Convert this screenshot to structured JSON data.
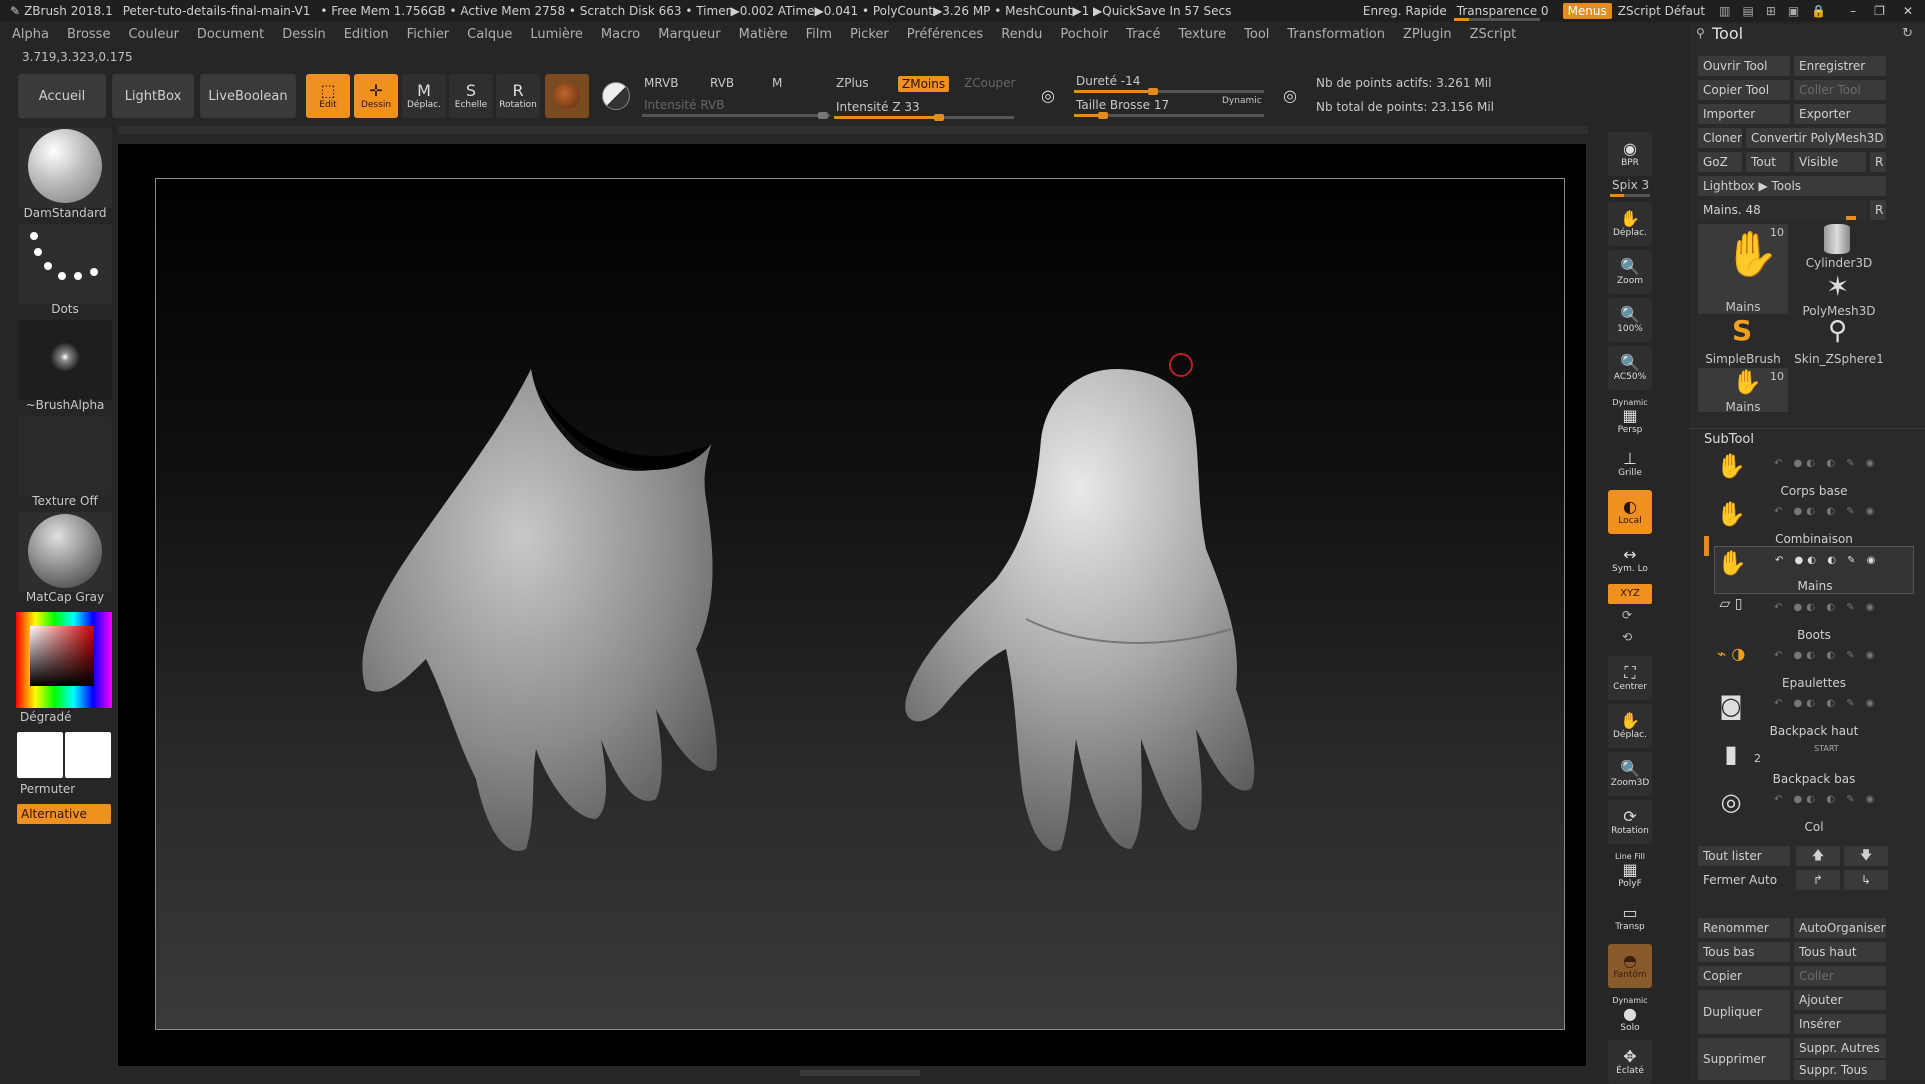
{
  "titlebar": {
    "app": "ZBrush 2018.1",
    "file": "Peter-tuto-details-final-main-V1",
    "stats": "• Free Mem 1.756GB • Active Mem 2758 • Scratch Disk 663 • Timer▶0.002 ATime▶0.041 • PolyCount▶3.26 MP • MeshCount▶1 ▶QuickSave In 57 Secs",
    "quicksave": "Enreg. Rapide",
    "transparence": "Transparence 0",
    "menus": "Menus",
    "zscript": "ZScript Défaut"
  },
  "menubar": [
    "Alpha",
    "Brosse",
    "Couleur",
    "Document",
    "Dessin",
    "Edition",
    "Fichier",
    "Calque",
    "Lumière",
    "Macro",
    "Marqueur",
    "Matière",
    "Film",
    "Picker",
    "Préférences",
    "Rendu",
    "Pochoir",
    "Tracé",
    "Texture",
    "Tool",
    "Transformation",
    "ZPlugin",
    "ZScript"
  ],
  "coords": "3.719,3.323,0.175",
  "topbar": {
    "accueil": "Accueil",
    "lightbox": "LightBox",
    "liveboolean": "LiveBoolean",
    "edit": "Edit",
    "dessin": "Dessin",
    "deplac": "Déplac.",
    "echelle": "Echelle",
    "rotation": "Rotation",
    "mrvb": "MRVB",
    "rvb": "RVB",
    "m": "M",
    "intensite_rvb": "Intensité RVB",
    "zplus": "ZPlus",
    "zmoins": "ZMoins",
    "zcouper": "ZCouper",
    "intensite_z": "Intensité Z 33",
    "durete": "Dureté -14",
    "taille_brosse": "Taille Brosse 17",
    "dynamic": "Dynamic",
    "points_actifs": "Nb de points actifs: 3.261 Mil",
    "points_total": "Nb total de points: 23.156 Mil",
    "intensite_z_value": 33,
    "durete_value": -14,
    "taille_brosse_value": 17
  },
  "leftpanel": {
    "brush": "DamStandard",
    "stroke": "Dots",
    "alpha": "~BrushAlpha",
    "texture": "Texture Off",
    "material": "MatCap Gray",
    "degrade": "Dégradé",
    "permuter": "Permuter",
    "alternative": "Alternative"
  },
  "rightstrip": {
    "bpr": "BPR",
    "spix": "Spix 3",
    "deplac": "Déplac.",
    "zoom": "Zoom",
    "actual": "100%",
    "aahalf": "AC50%",
    "persp_top": "Dynamic",
    "persp": "Persp",
    "grille": "Grille",
    "local": "Local",
    "symlo": "Sym. Lo",
    "xyz": "XYZ",
    "centrer": "Centrer",
    "deplac2": "Déplac.",
    "zoom3d": "Zoom3D",
    "rotation": "Rotation",
    "linefill": "Line Fill",
    "polyf": "PolyF",
    "transp": "Transp",
    "fantom": "Fantôm",
    "solo_top": "Dynamic",
    "solo": "Solo",
    "eclate": "Éclaté"
  },
  "toolpanel": {
    "title": "Tool",
    "ouvrir": "Ouvrir Tool",
    "enregistrer": "Enregistrer",
    "copier_tool": "Copier Tool",
    "coller_tool": "Coller Tool",
    "importer": "Importer",
    "exporter": "Exporter",
    "cloner": "Cloner",
    "convertir": "Convertir PolyMesh3D",
    "goz": "GoZ",
    "tout": "Tout",
    "visible": "Visible",
    "r": "R",
    "lightbox_tools": "Lightbox ▶ Tools",
    "mains_slider": "Mains. 48",
    "mains_value": 48,
    "thumbs": [
      {
        "name": "Mains",
        "count": "10"
      },
      {
        "name": "Cylinder3D",
        "count": ""
      },
      {
        "name": "PolyMesh3D",
        "count": ""
      },
      {
        "name": "SimpleBrush",
        "count": ""
      },
      {
        "name": "Skin_ZSphere1",
        "count": ""
      },
      {
        "name": "Mains",
        "count": "10"
      }
    ],
    "subtool_title": "SubTool",
    "subtools": [
      "Corps base",
      "Combinaison",
      "Mains",
      "Boots",
      "Epaulettes",
      "Backpack haut",
      "Backpack bas",
      "Col"
    ],
    "subtool_badge": "2",
    "subtool_start": "START",
    "tout_lister": "Tout lister",
    "fermer_auto": "Fermer Auto",
    "renommer": "Renommer",
    "autoorganiser": "AutoOrganiser",
    "tous_bas": "Tous bas",
    "tous_haut": "Tous haut",
    "copier": "Copier",
    "coller": "Coller",
    "dupliquer": "Dupliquer",
    "ajouter": "Ajouter",
    "inserer": "Insérer",
    "supprimer": "Supprimer",
    "suppr_autres": "Suppr. Autres",
    "suppr_tous": "Suppr. Tous"
  },
  "colors": {
    "accent": "#f0901e",
    "panel": "#2a2a2a",
    "background": "#262626"
  }
}
